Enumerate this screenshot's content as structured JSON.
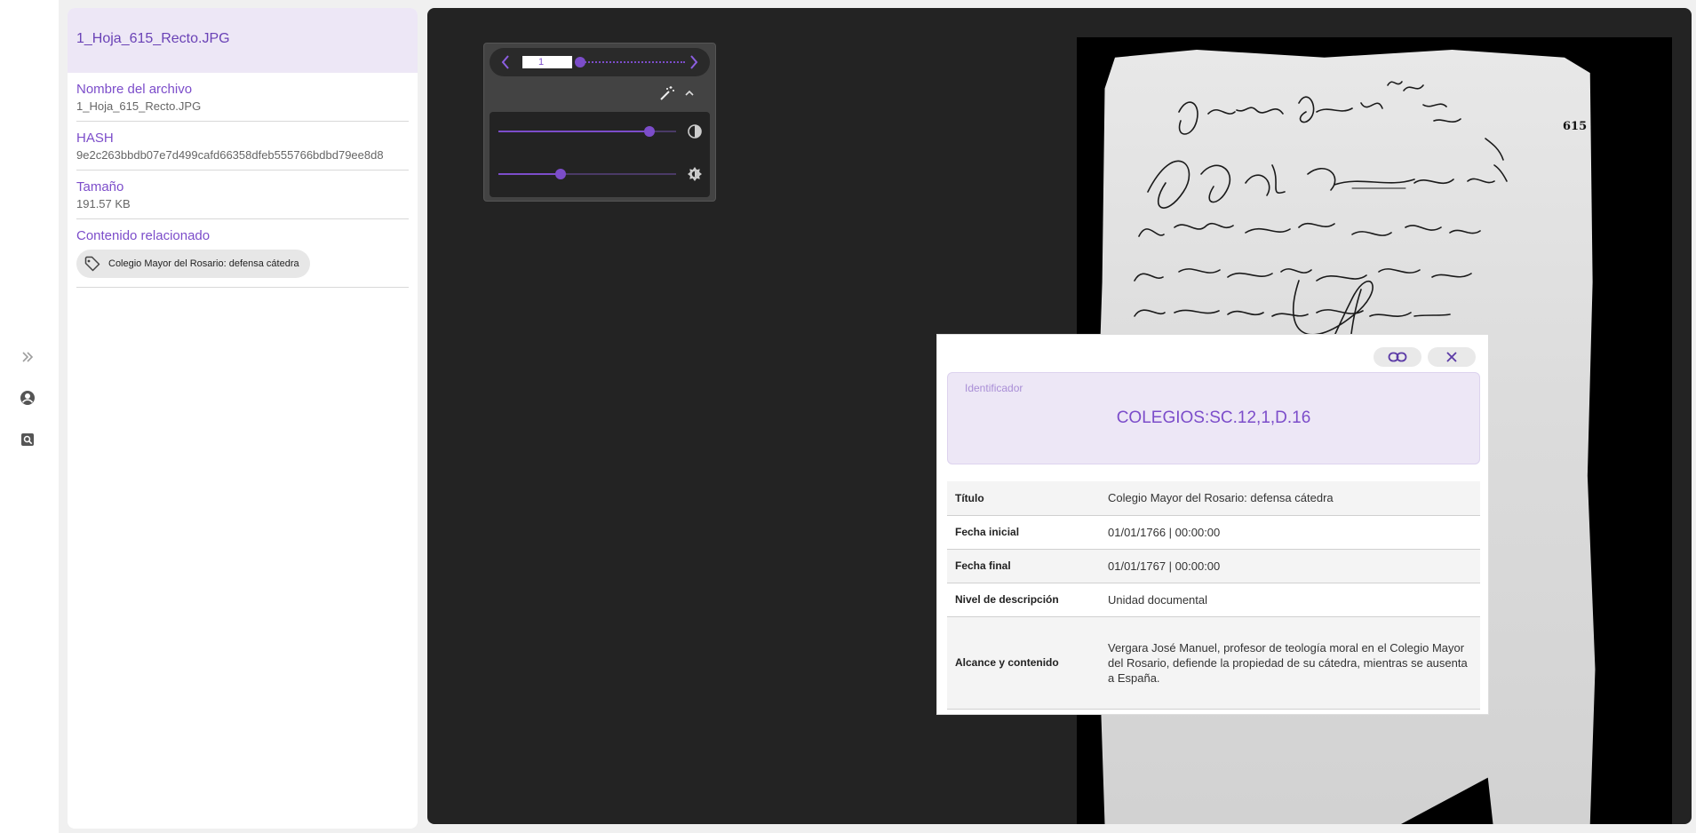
{
  "rail": {
    "items": [
      {
        "icon": "chevron-double-right-icon"
      },
      {
        "icon": "account-circle-icon"
      },
      {
        "icon": "document-search-icon"
      }
    ]
  },
  "file": {
    "header_name": "1_Hoja_615_Recto.JPG",
    "name_label": "Nombre del archivo",
    "name_value": "1_Hoja_615_Recto.JPG",
    "hash_label": "HASH",
    "hash_value": "9e2c263bbdb07e7d499cafd66358dfeb555766bdbd79ee8d8",
    "size_label": "Tamaño",
    "size_value": "191.57 KB",
    "related_label": "Contenido relacionado",
    "related_tag": "Colegio Mayor del Rosario: defensa cátedra"
  },
  "viewer": {
    "page_value": "1",
    "page_progress": 0.0,
    "contrast_level": 0.85,
    "brightness_level": 0.35,
    "page_mark": "615",
    "accent": "#7c4dca"
  },
  "metadata": {
    "identifier_label": "Identificador",
    "identifier_value": "COLEGIOS:SC.12,1,D.16",
    "rows": [
      {
        "key": "Título",
        "value": "Colegio Mayor del Rosario: defensa cátedra"
      },
      {
        "key": "Fecha inicial",
        "value": "01/01/1766 | 00:00:00"
      },
      {
        "key": "Fecha final",
        "value": "01/01/1767 | 00:00:00"
      },
      {
        "key": "Nivel de descripción",
        "value": "Unidad documental"
      },
      {
        "key": "Alcance y contenido",
        "value": "Vergara José Manuel, profesor de teología moral en el Colegio Mayor del Rosario, defiende la propiedad de su cátedra, mientras se ausenta a España."
      }
    ]
  }
}
